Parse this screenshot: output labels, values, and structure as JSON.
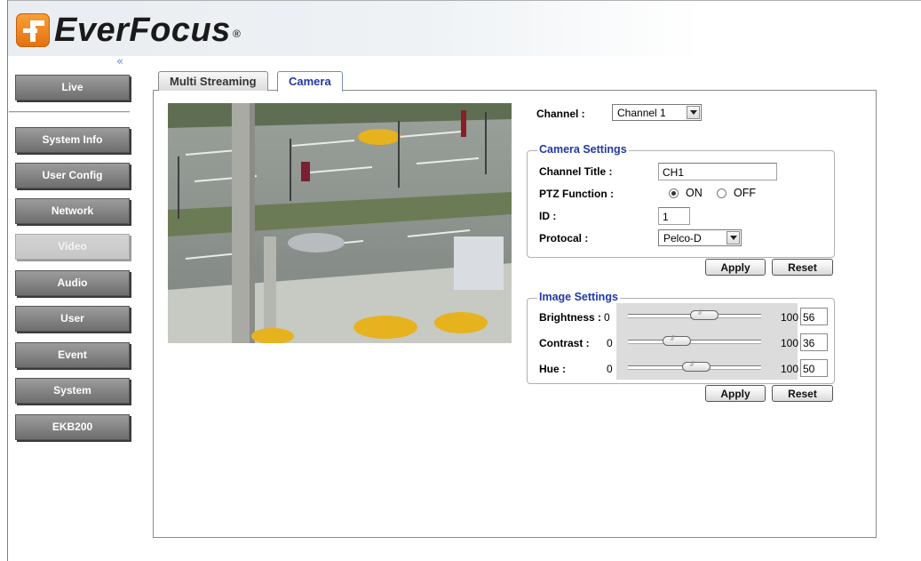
{
  "brand": {
    "name_part1": "Ever",
    "name_part2": "Focus",
    "registered": "®"
  },
  "sidebar": {
    "collapse_symbol": "«",
    "items": [
      {
        "label": "Live"
      },
      {
        "label": "System Info"
      },
      {
        "label": "User Config"
      },
      {
        "label": "Network"
      },
      {
        "label": "Video",
        "active": true
      },
      {
        "label": "Audio"
      },
      {
        "label": "User"
      },
      {
        "label": "Event"
      },
      {
        "label": "System"
      },
      {
        "label": "EKB200"
      }
    ]
  },
  "tabs": [
    {
      "label": "Multi Streaming"
    },
    {
      "label": "Camera",
      "selected": true
    }
  ],
  "channel": {
    "label": "Channel :",
    "selected": "Channel 1"
  },
  "camera_settings": {
    "legend": "Camera Settings",
    "channel_title_label": "Channel Title :",
    "channel_title_value": "CH1",
    "ptz_label": "PTZ Function :",
    "ptz_on_label": "ON",
    "ptz_off_label": "OFF",
    "ptz_value": "ON",
    "id_label": "ID :",
    "id_value": "1",
    "protocol_label": "Protocal :",
    "protocol_value": "Pelco-D",
    "apply_label": "Apply",
    "reset_label": "Reset"
  },
  "image_settings": {
    "legend": "Image Settings",
    "brightness": {
      "label": "Brightness :",
      "min": "0",
      "max": "100",
      "value": "56"
    },
    "contrast": {
      "label": "Contrast :",
      "min": "0",
      "max": "100",
      "value": "36"
    },
    "hue": {
      "label": "Hue :",
      "min": "0",
      "max": "100",
      "value": "50"
    },
    "apply_label": "Apply",
    "reset_label": "Reset"
  },
  "colors": {
    "accent_blue": "#2238a6",
    "nav_gray": "#858585",
    "logo_orange": "#e36f10"
  }
}
